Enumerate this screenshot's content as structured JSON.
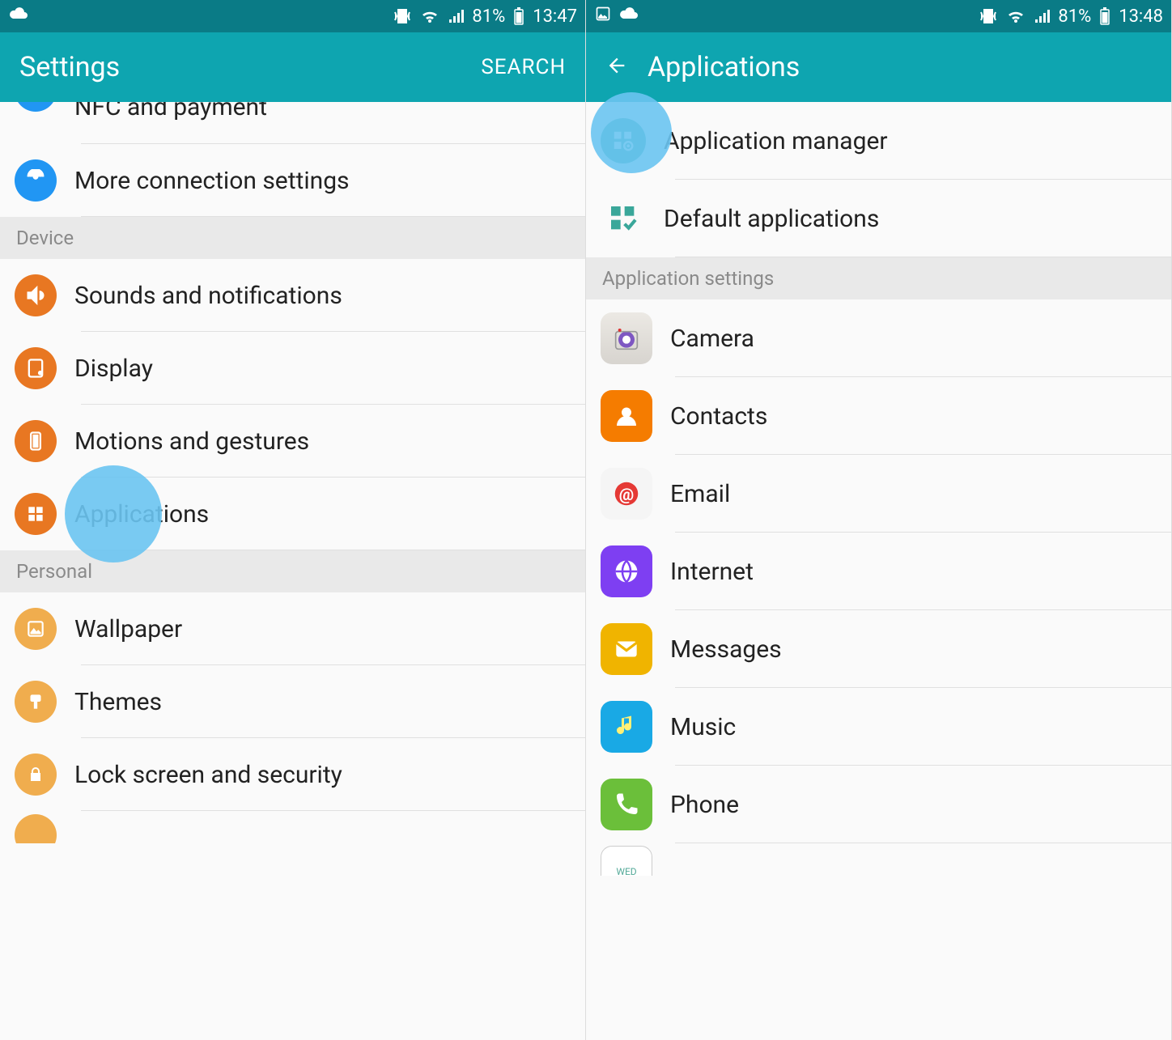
{
  "left": {
    "status": {
      "battery": "81%",
      "time": "13:47"
    },
    "appbar": {
      "title": "Settings",
      "action": "SEARCH"
    },
    "rows": {
      "nfc": "NFC and payment",
      "more_conn": "More connection settings",
      "device_header": "Device",
      "sounds": "Sounds and notifications",
      "display": "Display",
      "motions": "Motions and gestures",
      "applications": "Applications",
      "personal_header": "Personal",
      "wallpaper": "Wallpaper",
      "themes": "Themes",
      "lock": "Lock screen and security"
    }
  },
  "right": {
    "status": {
      "battery": "81%",
      "time": "13:48"
    },
    "appbar": {
      "title": "Applications"
    },
    "top": {
      "appmgr": "Application manager",
      "default": "Default applications"
    },
    "section": "Application settings",
    "apps": {
      "camera": "Camera",
      "contacts": "Contacts",
      "email": "Email",
      "internet": "Internet",
      "messages": "Messages",
      "music": "Music",
      "phone": "Phone"
    }
  }
}
